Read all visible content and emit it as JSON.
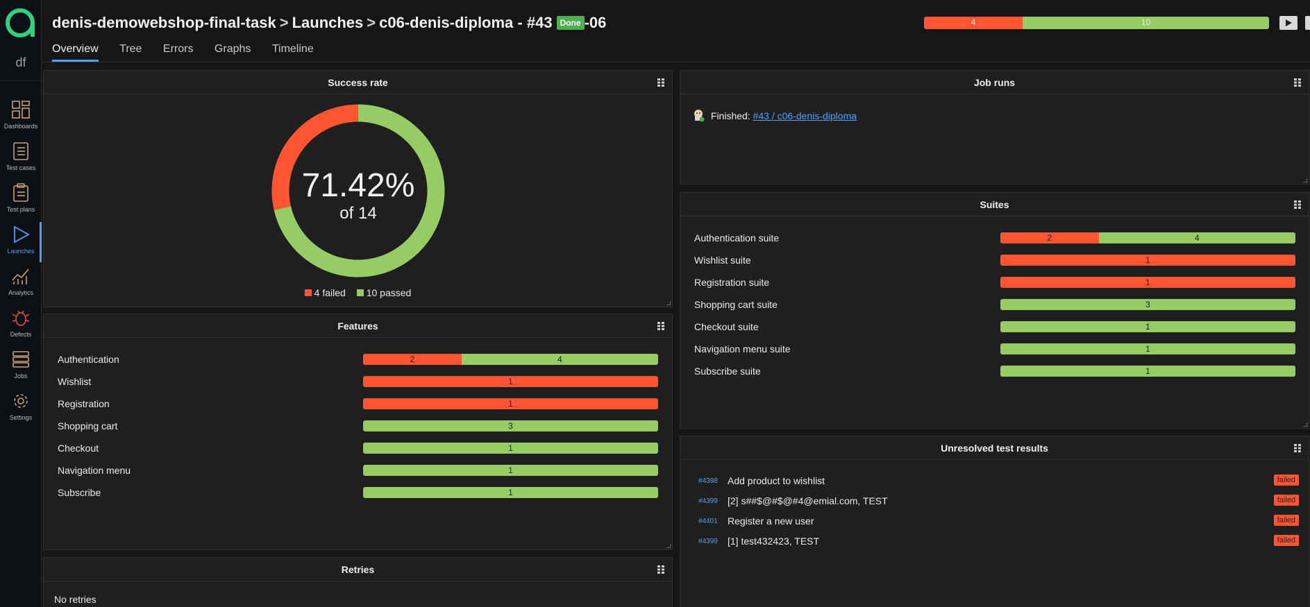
{
  "sidebar": {
    "workspace": "df",
    "items": [
      {
        "label": "Dashboards"
      },
      {
        "label": "Test cases"
      },
      {
        "label": "Test plans"
      },
      {
        "label": "Launches"
      },
      {
        "label": "Analytics"
      },
      {
        "label": "Defects"
      },
      {
        "label": "Jobs"
      },
      {
        "label": "Settings"
      }
    ]
  },
  "header": {
    "project": "denis-demowebshop-final-task",
    "sep": ">",
    "section": "Launches",
    "launch_name": "c06-denis-diploma - #43",
    "status_badge": "Done",
    "launch_suffix": "-06",
    "tabs": [
      "Overview",
      "Tree",
      "Errors",
      "Graphs",
      "Timeline"
    ],
    "summary": {
      "failed": 4,
      "passed": 10
    }
  },
  "colors": {
    "failed": "#ff5533",
    "passed": "#96cc64",
    "accent": "#4ea1ff"
  },
  "success_rate": {
    "title": "Success rate",
    "percent": "71.42%",
    "of_label": "of 14",
    "legend_failed": "4 failed",
    "legend_passed": "10 passed"
  },
  "features": {
    "title": "Features",
    "rows": [
      {
        "name": "Authentication",
        "failed": 2,
        "passed": 4
      },
      {
        "name": "Wishlist",
        "failed": 1,
        "passed": 0
      },
      {
        "name": "Registration",
        "failed": 1,
        "passed": 0
      },
      {
        "name": "Shopping cart",
        "failed": 0,
        "passed": 3
      },
      {
        "name": "Checkout",
        "failed": 0,
        "passed": 1
      },
      {
        "name": "Navigation menu",
        "failed": 0,
        "passed": 1
      },
      {
        "name": "Subscribe",
        "failed": 0,
        "passed": 1
      }
    ]
  },
  "retries": {
    "title": "Retries",
    "text": "No retries"
  },
  "job_runs": {
    "title": "Job runs",
    "prefix": "Finished:",
    "link": "#43 / c06-denis-diploma"
  },
  "suites": {
    "title": "Suites",
    "rows": [
      {
        "name": "Authentication suite",
        "failed": 2,
        "passed": 4
      },
      {
        "name": "Wishlist suite",
        "failed": 1,
        "passed": 0
      },
      {
        "name": "Registration suite",
        "failed": 1,
        "passed": 0
      },
      {
        "name": "Shopping cart suite",
        "failed": 0,
        "passed": 3
      },
      {
        "name": "Checkout suite",
        "failed": 0,
        "passed": 1
      },
      {
        "name": "Navigation menu suite",
        "failed": 0,
        "passed": 1
      },
      {
        "name": "Subscribe suite",
        "failed": 0,
        "passed": 1
      }
    ]
  },
  "unresolved": {
    "title": "Unresolved test results",
    "rows": [
      {
        "id": "#4398",
        "name": "Add product to wishlist",
        "status": "failed"
      },
      {
        "id": "#4399",
        "name": "[2] s##$@#$@#4@emial.com, TEST",
        "status": "failed"
      },
      {
        "id": "#4401",
        "name": "Register a new user",
        "status": "failed"
      },
      {
        "id": "#4399",
        "name": "[1] test432423, TEST",
        "status": "failed"
      }
    ]
  }
}
